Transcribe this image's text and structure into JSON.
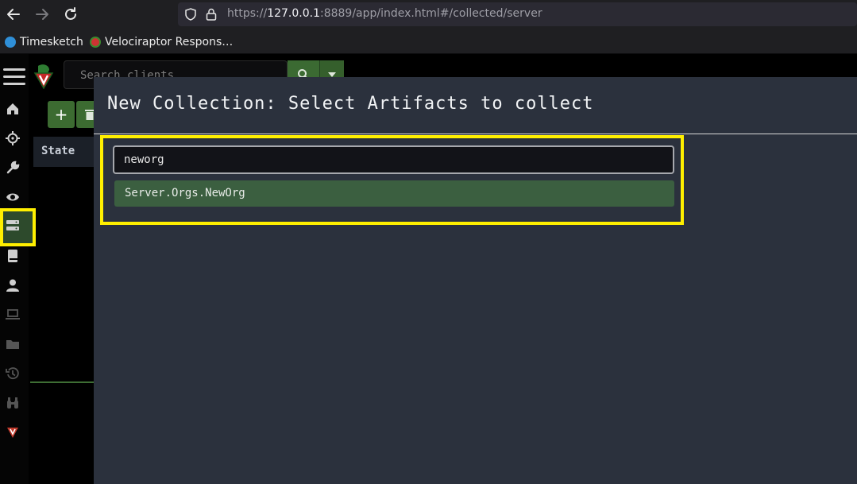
{
  "browser": {
    "url_prefix": "https://",
    "url_host": "127.0.0.1",
    "url_rest": ":8889/app/index.html#/collected/server",
    "bookmarks": [
      {
        "label": "Timesketch",
        "icon": "timesketch-icon"
      },
      {
        "label": "Velociraptor Respons…",
        "icon": "velociraptor-icon"
      }
    ]
  },
  "app": {
    "search": {
      "placeholder": "Search clients"
    },
    "table": {
      "state_header": "State"
    },
    "sidebar_icons": [
      "menu-icon",
      "home-icon",
      "crosshair-icon",
      "wrench-icon",
      "eye-icon",
      "server-icon",
      "book-icon",
      "user-icon",
      "laptop-icon",
      "folder-icon",
      "history-icon",
      "binoculars-icon",
      "velociraptor-icon"
    ]
  },
  "modal": {
    "title": "New Collection: Select Artifacts to collect",
    "search_value": "neworg",
    "results": [
      {
        "label": "Server.Orgs.NewOrg"
      }
    ]
  },
  "colors": {
    "highlight": "#ffef00",
    "accent_green": "#3c6b31",
    "modal_bg": "#2b313d"
  }
}
